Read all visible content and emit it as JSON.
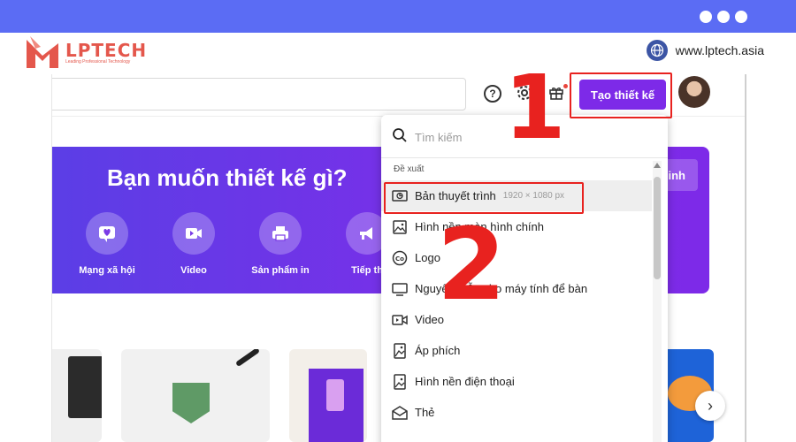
{
  "brand": {
    "logo_name": "LPTECH",
    "logo_tagline": "Leading Professional Technology",
    "website": "www.lptech.asia"
  },
  "header": {
    "search_placeholder": "",
    "create_button": "Tạo thiết kế",
    "icons": [
      "help-icon",
      "gear-icon",
      "gift-icon"
    ]
  },
  "banner": {
    "title": "Bạn muốn thiết kế gì?",
    "right_button": "inh",
    "categories": [
      {
        "label": "Mạng xã hội",
        "icon": "heart-icon"
      },
      {
        "label": "Video",
        "icon": "video-icon"
      },
      {
        "label": "Sản phẩm in",
        "icon": "printer-icon"
      },
      {
        "label": "Tiếp th",
        "icon": "megaphone-icon"
      }
    ]
  },
  "dropdown": {
    "search_placeholder": "Tìm kiếm",
    "section": "Đề xuất",
    "items": [
      {
        "label": "Bản thuyết trình",
        "dim": "1920 × 1080 px",
        "icon": "presentation-icon"
      },
      {
        "label": "Hình nền màn hình chính",
        "icon": "image-icon"
      },
      {
        "label": "Logo",
        "icon": "logo-icon"
      },
      {
        "label": "Nguyên mẫu cho máy tính để bàn",
        "icon": "monitor-icon"
      },
      {
        "label": "Video",
        "icon": "video-icon"
      },
      {
        "label": "Áp phích",
        "icon": "poster-icon"
      },
      {
        "label": "Hình nền điện thoại",
        "icon": "phone-wallpaper-icon"
      },
      {
        "label": "Thẻ",
        "icon": "card-icon"
      }
    ]
  },
  "annotations": {
    "step1": "1",
    "step2": "2"
  },
  "colors": {
    "topbar": "#5b6cf4",
    "brand_red": "#e4574c",
    "canva_purple": "#7d2ae8",
    "annotation_red": "#e8221f"
  }
}
